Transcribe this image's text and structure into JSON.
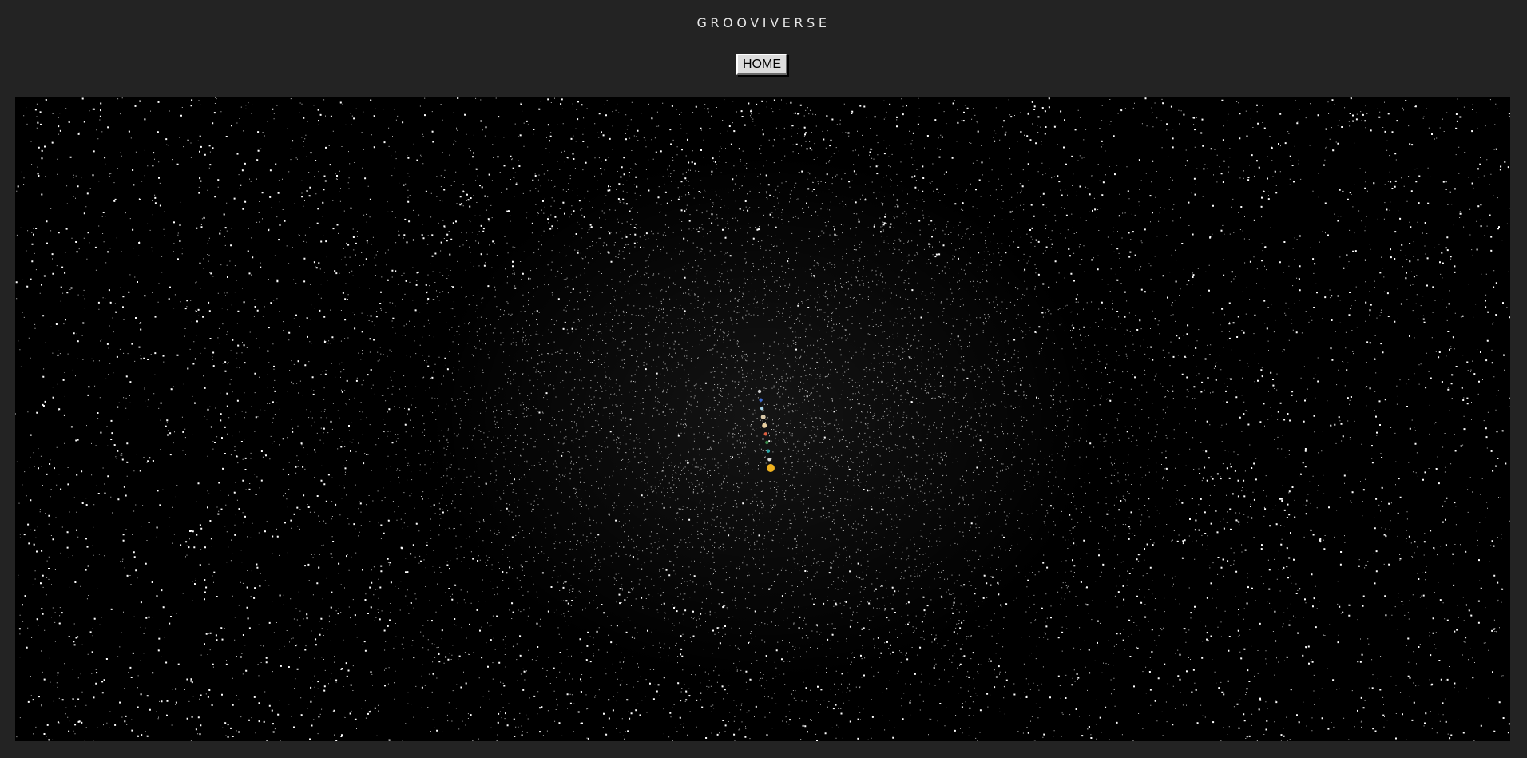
{
  "header": {
    "title": "GROOVIVERSE"
  },
  "nav": {
    "home_label": "HOME"
  },
  "scene": {
    "background_color": "#000000",
    "star_color": "#ffffff",
    "planets": [
      {
        "name": "sun",
        "color": "#f0b21e"
      },
      {
        "name": "mercury",
        "color": "#d9d9d9"
      },
      {
        "name": "venus",
        "color": "#2aa6a6"
      },
      {
        "name": "earth",
        "color": "#3a8a4a"
      },
      {
        "name": "mars",
        "color": "#e06040"
      },
      {
        "name": "jupiter",
        "color": "#e8cfa0"
      },
      {
        "name": "saturn",
        "color": "#d8c8a8"
      },
      {
        "name": "uranus",
        "color": "#a9d5e8"
      },
      {
        "name": "neptune",
        "color": "#3f6fd8"
      },
      {
        "name": "pluto",
        "color": "#cfcfcf"
      }
    ]
  }
}
